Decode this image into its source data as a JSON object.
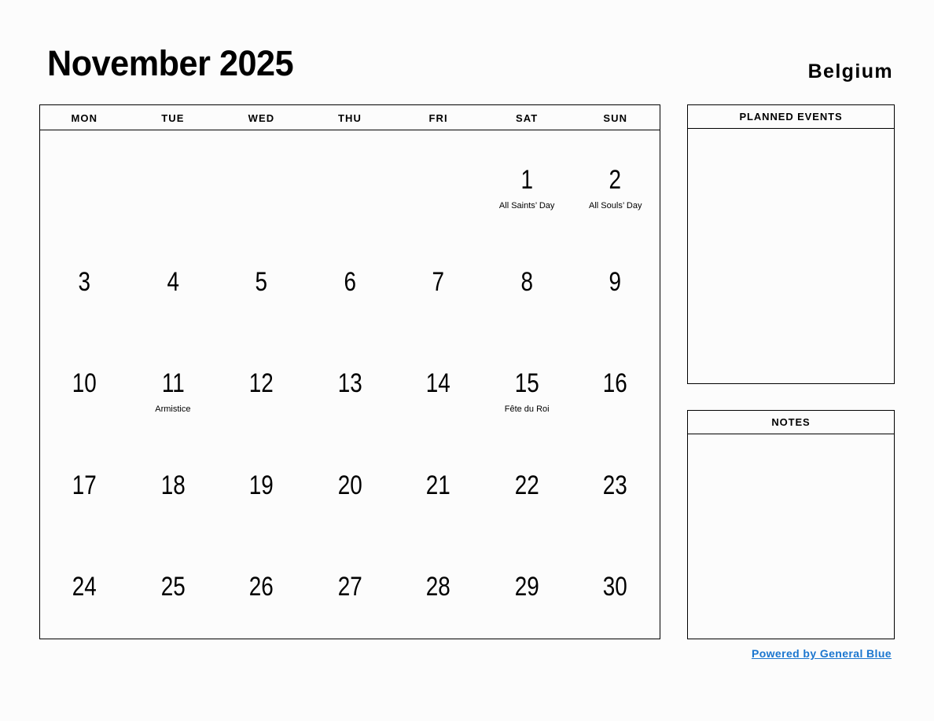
{
  "header": {
    "month_title": "November 2025",
    "country": "Belgium"
  },
  "calendar": {
    "weekday_headers": [
      "MON",
      "TUE",
      "WED",
      "THU",
      "FRI",
      "SAT",
      "SUN"
    ],
    "weeks": [
      [
        {
          "date": "",
          "holiday": ""
        },
        {
          "date": "",
          "holiday": ""
        },
        {
          "date": "",
          "holiday": ""
        },
        {
          "date": "",
          "holiday": ""
        },
        {
          "date": "",
          "holiday": ""
        },
        {
          "date": "1",
          "holiday": "All Saints’ Day"
        },
        {
          "date": "2",
          "holiday": "All Souls’ Day"
        }
      ],
      [
        {
          "date": "3",
          "holiday": ""
        },
        {
          "date": "4",
          "holiday": ""
        },
        {
          "date": "5",
          "holiday": ""
        },
        {
          "date": "6",
          "holiday": ""
        },
        {
          "date": "7",
          "holiday": ""
        },
        {
          "date": "8",
          "holiday": ""
        },
        {
          "date": "9",
          "holiday": ""
        }
      ],
      [
        {
          "date": "10",
          "holiday": ""
        },
        {
          "date": "11",
          "holiday": "Armistice"
        },
        {
          "date": "12",
          "holiday": ""
        },
        {
          "date": "13",
          "holiday": ""
        },
        {
          "date": "14",
          "holiday": ""
        },
        {
          "date": "15",
          "holiday": "Fête du Roi"
        },
        {
          "date": "16",
          "holiday": ""
        }
      ],
      [
        {
          "date": "17",
          "holiday": ""
        },
        {
          "date": "18",
          "holiday": ""
        },
        {
          "date": "19",
          "holiday": ""
        },
        {
          "date": "20",
          "holiday": ""
        },
        {
          "date": "21",
          "holiday": ""
        },
        {
          "date": "22",
          "holiday": ""
        },
        {
          "date": "23",
          "holiday": ""
        }
      ],
      [
        {
          "date": "24",
          "holiday": ""
        },
        {
          "date": "25",
          "holiday": ""
        },
        {
          "date": "26",
          "holiday": ""
        },
        {
          "date": "27",
          "holiday": ""
        },
        {
          "date": "28",
          "holiday": ""
        },
        {
          "date": "29",
          "holiday": ""
        },
        {
          "date": "30",
          "holiday": ""
        }
      ]
    ]
  },
  "sidebar": {
    "planned_events": {
      "title": "PLANNED EVENTS",
      "content": ""
    },
    "notes": {
      "title": "NOTES",
      "content": ""
    }
  },
  "footer": {
    "link_label": "Powered by General Blue",
    "link_color": "#1b76cf"
  }
}
